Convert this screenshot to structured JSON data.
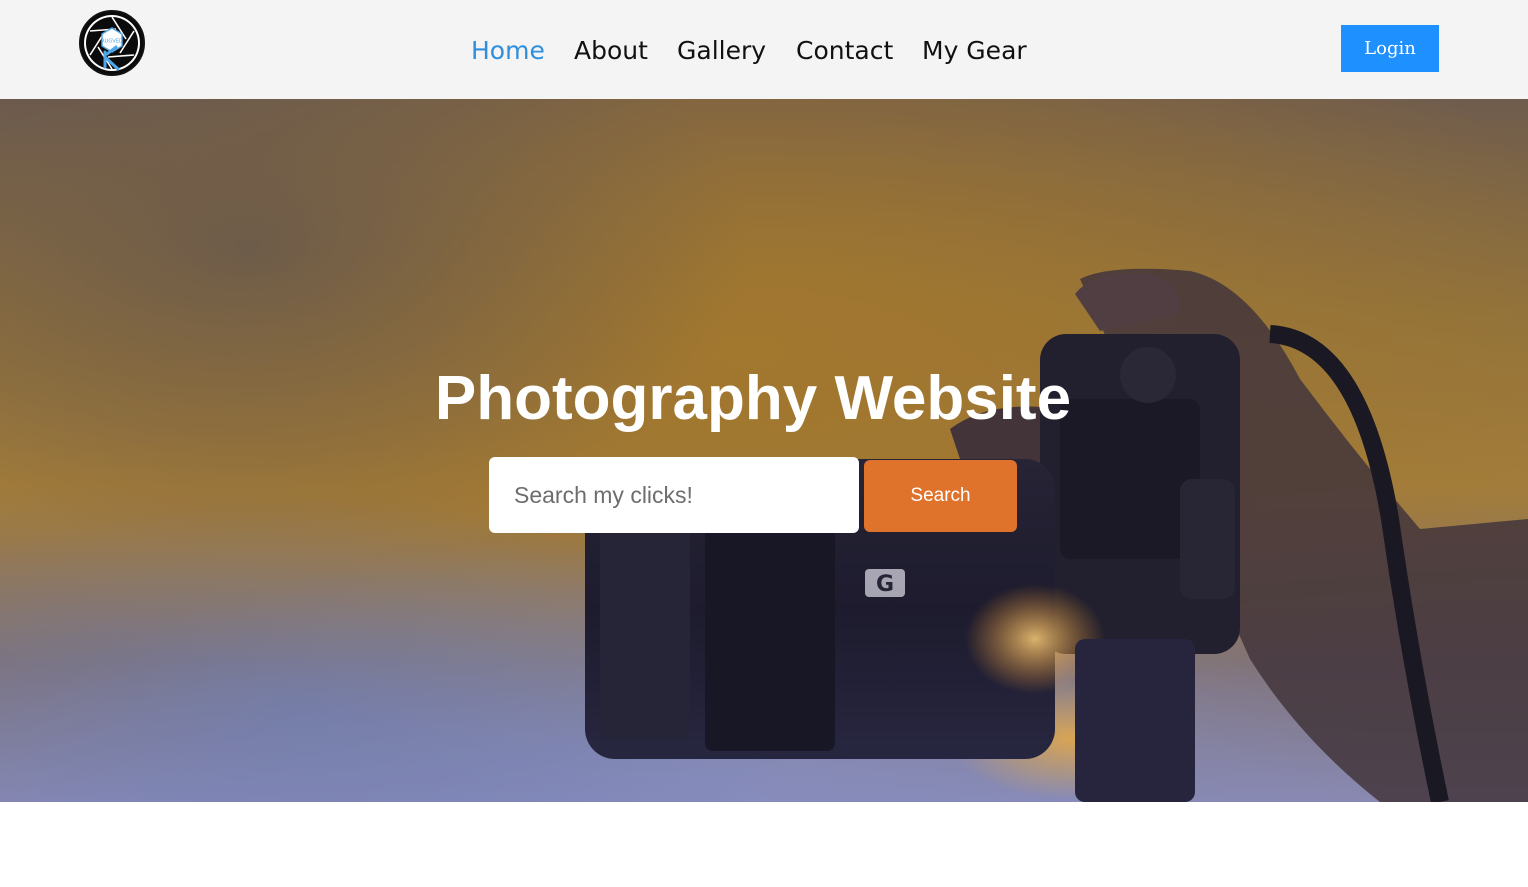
{
  "brand": {
    "logo_icon": "camera-aperture-logo",
    "logo_text": "RUGVED"
  },
  "nav": {
    "items": [
      {
        "label": "Home",
        "active": true
      },
      {
        "label": "About",
        "active": false
      },
      {
        "label": "Gallery",
        "active": false
      },
      {
        "label": "Contact",
        "active": false
      },
      {
        "label": "My Gear",
        "active": false
      }
    ],
    "login_label": "Login"
  },
  "hero": {
    "title": "Photography Website",
    "search": {
      "placeholder": "Search my clicks!",
      "value": "",
      "button_label": "Search"
    }
  },
  "colors": {
    "nav_bg": "#f4f4f4",
    "nav_active": "#2f8fdc",
    "login_bg": "#1e90ff",
    "search_button_bg": "#e0732b"
  }
}
